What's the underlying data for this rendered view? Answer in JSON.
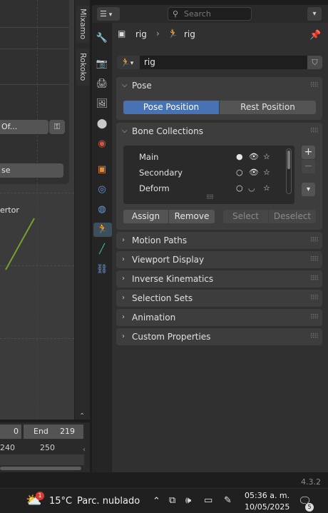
{
  "sidebar_tabs": [
    "Mixamo",
    "Rokoko"
  ],
  "viewport": {
    "field1": "Of...",
    "field2": "se",
    "object_label": "ertor"
  },
  "timeline": {
    "start_value": "0",
    "end_label": "End",
    "end_value": "219",
    "ruler_ticks": [
      "240",
      "250"
    ]
  },
  "properties": {
    "search_placeholder": "Search",
    "breadcrumb": {
      "object": "rig",
      "data": "rig"
    },
    "datablock_name": "rig",
    "pose_panel": {
      "title": "Pose",
      "pose_position": "Pose Position",
      "rest_position": "Rest Position"
    },
    "bone_collections": {
      "title": "Bone Collections",
      "items": [
        {
          "name": "Main",
          "active": true,
          "visible": true
        },
        {
          "name": "Secondary",
          "active": false,
          "visible": true
        },
        {
          "name": "Deform",
          "active": false,
          "visible": false
        }
      ],
      "buttons": {
        "assign": "Assign",
        "remove": "Remove",
        "select": "Select",
        "deselect": "Deselect"
      }
    },
    "collapsed_panels": [
      "Motion Paths",
      "Viewport Display",
      "Inverse Kinematics",
      "Selection Sets",
      "Animation",
      "Custom Properties"
    ]
  },
  "status": {
    "version": "4.3.2"
  },
  "taskbar": {
    "temperature": "15°C",
    "weather": "Parc. nublado",
    "weather_badge": "1",
    "time": "05:36 a. m.",
    "date": "10/05/2025",
    "notification_count": "5"
  },
  "colors": {
    "accent": "#4772b3",
    "bone_green": "#76a030",
    "panel": "#3d3d3d"
  }
}
